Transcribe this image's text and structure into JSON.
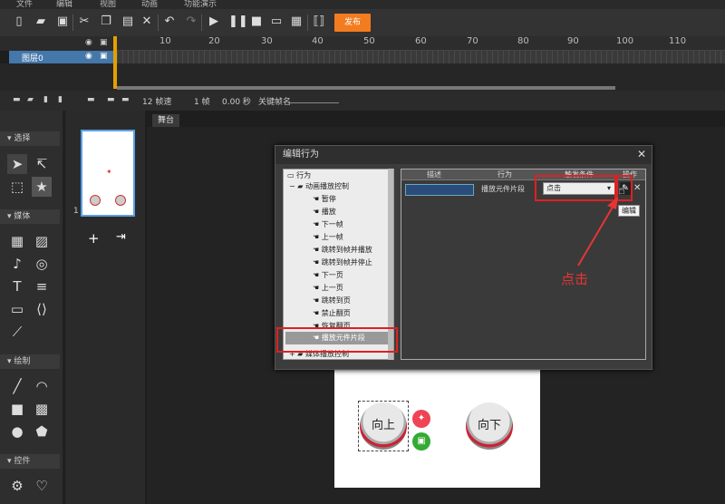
{
  "menu": {
    "file": "文件",
    "edit": "编辑",
    "view": "视图",
    "anim": "动画",
    "demo": "功能演示"
  },
  "toolbar": {
    "publish": "发布"
  },
  "timeline": {
    "ruler": [
      "10",
      "20",
      "30",
      "40",
      "50",
      "60",
      "70",
      "80",
      "90",
      "100",
      "110"
    ],
    "layer": "图层0"
  },
  "status": {
    "fps": "12 帧速",
    "frame": "1 帧",
    "time": "0.00 秒",
    "keyframe_name": "关键帧名"
  },
  "left_panel": {
    "select": "选择",
    "media": "媒体",
    "draw": "绘制",
    "controls": "控件"
  },
  "pages": {
    "page_number": "1"
  },
  "stage": {
    "tab": "舞台"
  },
  "dialog": {
    "title": "编辑行为",
    "tree": {
      "root": "行为",
      "group1": "动画播放控制",
      "items": [
        "暂停",
        "播放",
        "下一帧",
        "上一帧",
        "跳转到帧并播放",
        "跳转到帧并停止",
        "下一页",
        "上一页",
        "跳转到页",
        "禁止翻页",
        "恢复翻页",
        "播放元件片段"
      ],
      "group2": "媒体播放控制"
    },
    "columns": [
      "描述",
      "行为",
      "触发条件",
      "操作"
    ],
    "row": {
      "desc": "",
      "action": "播放元件片段",
      "trigger": "点击"
    }
  },
  "tooltip": "编辑",
  "annotation": "点击",
  "canvas": {
    "up": "向上",
    "down": "向下"
  }
}
